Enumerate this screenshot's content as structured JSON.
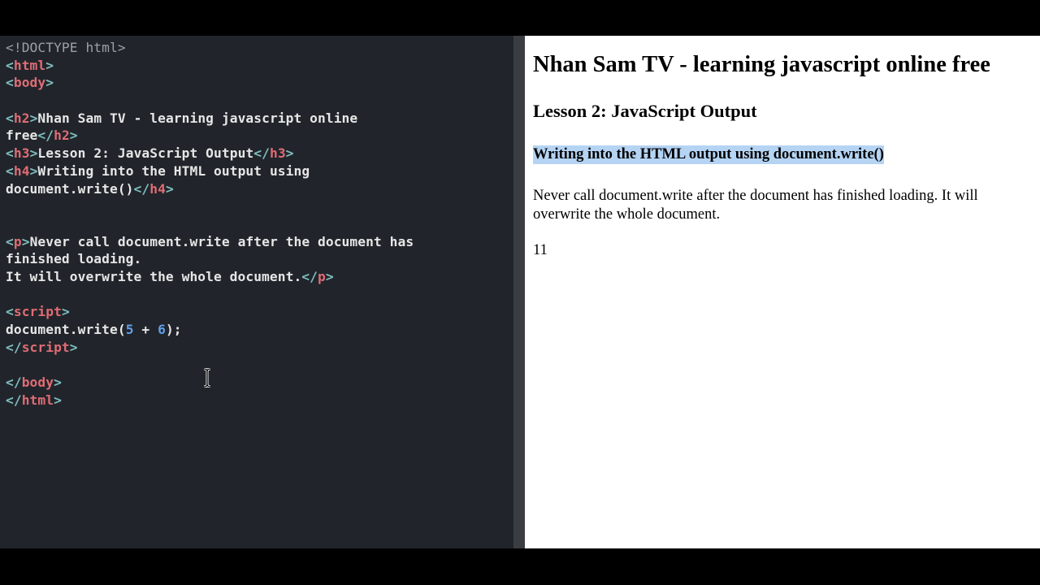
{
  "editor": {
    "lines": [
      [
        {
          "c": "t-doctype",
          "t": "<!DOCTYPE html>"
        }
      ],
      [
        {
          "c": "t-punc",
          "t": "<"
        },
        {
          "c": "t-tag",
          "t": "html"
        },
        {
          "c": "t-punc",
          "t": ">"
        }
      ],
      [
        {
          "c": "t-punc",
          "t": "<"
        },
        {
          "c": "t-tag",
          "t": "body"
        },
        {
          "c": "t-punc",
          "t": ">"
        }
      ],
      [],
      [
        {
          "c": "t-punc",
          "t": "<"
        },
        {
          "c": "t-tag",
          "t": "h2"
        },
        {
          "c": "t-punc",
          "t": ">"
        },
        {
          "c": "t-text",
          "t": "Nhan Sam TV - learning javascript online"
        }
      ],
      [
        {
          "c": "t-text",
          "t": "free"
        },
        {
          "c": "t-punc",
          "t": "</"
        },
        {
          "c": "t-tag",
          "t": "h2"
        },
        {
          "c": "t-punc",
          "t": ">"
        }
      ],
      [
        {
          "c": "t-punc",
          "t": "<"
        },
        {
          "c": "t-tag",
          "t": "h3"
        },
        {
          "c": "t-punc",
          "t": ">"
        },
        {
          "c": "t-text",
          "t": "Lesson 2: JavaScript Output"
        },
        {
          "c": "t-punc",
          "t": "</"
        },
        {
          "c": "t-tag",
          "t": "h3"
        },
        {
          "c": "t-punc",
          "t": ">"
        }
      ],
      [
        {
          "c": "t-punc",
          "t": "<"
        },
        {
          "c": "t-tag",
          "t": "h4"
        },
        {
          "c": "t-punc",
          "t": ">"
        },
        {
          "c": "t-text",
          "t": "Writing into the HTML output using"
        }
      ],
      [
        {
          "c": "t-text",
          "t": "document.write()"
        },
        {
          "c": "t-punc",
          "t": "</"
        },
        {
          "c": "t-tag",
          "t": "h4"
        },
        {
          "c": "t-punc",
          "t": ">"
        }
      ],
      [],
      [],
      [
        {
          "c": "t-punc",
          "t": "<"
        },
        {
          "c": "t-tag",
          "t": "p"
        },
        {
          "c": "t-punc",
          "t": ">"
        },
        {
          "c": "t-text",
          "t": "Never call document.write after the document has"
        }
      ],
      [
        {
          "c": "t-text",
          "t": "finished loading."
        }
      ],
      [
        {
          "c": "t-text",
          "t": "It will overwrite the whole document."
        },
        {
          "c": "t-punc",
          "t": "</"
        },
        {
          "c": "t-tag",
          "t": "p"
        },
        {
          "c": "t-punc",
          "t": ">"
        }
      ],
      [],
      [
        {
          "c": "t-punc",
          "t": "<"
        },
        {
          "c": "t-tag",
          "t": "script"
        },
        {
          "c": "t-punc",
          "t": ">"
        }
      ],
      [
        {
          "c": "t-text",
          "t": "document.write("
        },
        {
          "c": "t-num",
          "t": "5"
        },
        {
          "c": "t-text",
          "t": " + "
        },
        {
          "c": "t-num",
          "t": "6"
        },
        {
          "c": "t-text",
          "t": ");"
        }
      ],
      [
        {
          "c": "t-punc",
          "t": "</"
        },
        {
          "c": "t-tag",
          "t": "script"
        },
        {
          "c": "t-punc",
          "t": ">"
        }
      ],
      [],
      [
        {
          "c": "t-punc",
          "t": "</"
        },
        {
          "c": "t-tag",
          "t": "body"
        },
        {
          "c": "t-punc",
          "t": ">"
        }
      ],
      [
        {
          "c": "t-punc",
          "t": "</"
        },
        {
          "c": "t-tag",
          "t": "html"
        },
        {
          "c": "t-punc",
          "t": ">"
        }
      ]
    ],
    "cursor_icon": "text-cursor-icon"
  },
  "preview": {
    "h2": "Nhan Sam TV - learning javascript online free",
    "h3": "Lesson 2: JavaScript Output",
    "h4": "Writing into the HTML output using document.write()",
    "paragraph": "Never call document.write after the document has finished loading. It will overwrite the whole document.",
    "output": "11"
  },
  "colors": {
    "editor_bg": "#21252b",
    "tag": "#e06c75",
    "punctuation": "#7fbfbf",
    "number": "#61a0e8",
    "selection_highlight": "#b5d4f4"
  }
}
